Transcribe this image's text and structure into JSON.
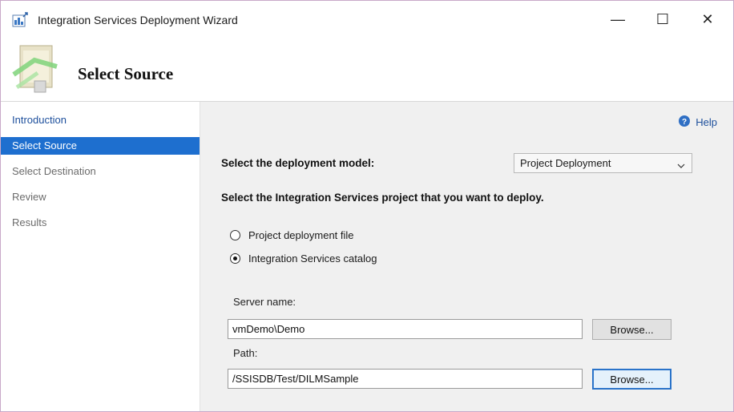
{
  "window": {
    "title": "Integration Services Deployment Wizard",
    "minimize_glyph": "—",
    "maximize_glyph": "☐",
    "close_glyph": "✕"
  },
  "header": {
    "title": "Select Source",
    "icon": "wizard-header-icon"
  },
  "sidebar": {
    "items": [
      {
        "label": "Introduction",
        "state": "link"
      },
      {
        "label": "Select Source",
        "state": "active"
      },
      {
        "label": "Select Destination",
        "state": "disabled"
      },
      {
        "label": "Review",
        "state": "disabled"
      },
      {
        "label": "Results",
        "state": "disabled"
      }
    ]
  },
  "main": {
    "help_label": "Help",
    "deployment_model_label": "Select the deployment model:",
    "deployment_model_value": "Project Deployment",
    "project_prompt": "Select the Integration Services project that you want to deploy.",
    "options": [
      {
        "label": "Project deployment file",
        "checked": false
      },
      {
        "label": "Integration Services catalog",
        "checked": true
      }
    ],
    "server_name_label": "Server name:",
    "server_name_value": "vmDemo\\Demo",
    "server_browse_label": "Browse...",
    "path_label": "Path:",
    "path_value": "/SSISDB/Test/DILMSample",
    "path_browse_label": "Browse..."
  },
  "colors": {
    "accent": "#1e6fcf",
    "link": "#1d4f9c",
    "panel_bg": "#f0f0f0"
  }
}
